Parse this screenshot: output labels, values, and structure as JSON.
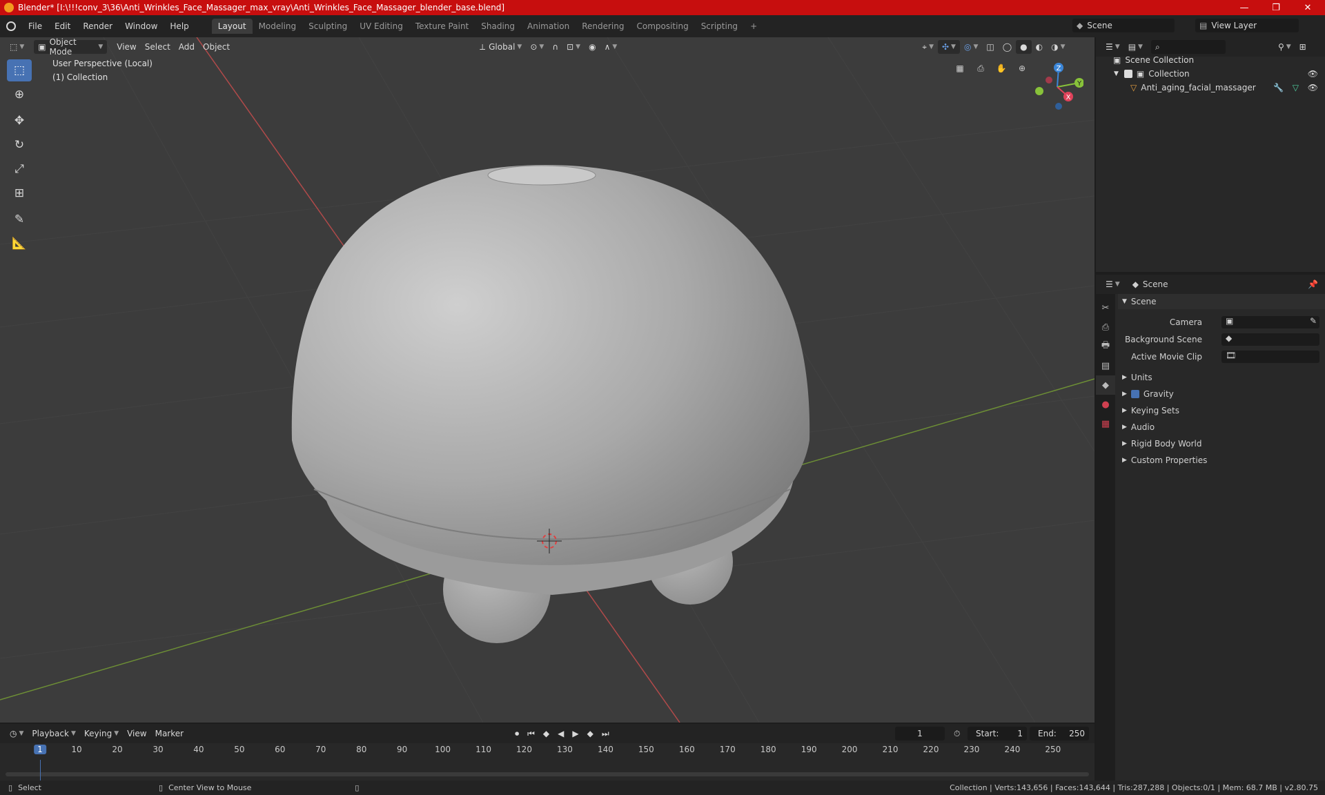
{
  "window": {
    "title": "Blender* [I:\\!!!conv_3\\36\\Anti_Wrinkles_Face_Massager_max_vray\\Anti_Wrinkles_Face_Massager_blender_base.blend]",
    "minimize": "—",
    "maximize": "❐",
    "close": "✕"
  },
  "menu": {
    "items": [
      "File",
      "Edit",
      "Render",
      "Window",
      "Help"
    ],
    "workspaces": [
      "Layout",
      "Modeling",
      "Sculpting",
      "UV Editing",
      "Texture Paint",
      "Shading",
      "Animation",
      "Rendering",
      "Compositing",
      "Scripting"
    ],
    "add_workspace": "+",
    "scene": "Scene",
    "view_layer": "View Layer"
  },
  "viewport_header": {
    "mode": "Object Mode",
    "menus": [
      "View",
      "Select",
      "Add",
      "Object"
    ],
    "orientation": "Global"
  },
  "viewport": {
    "overlay_line1": "User Perspective (Local)",
    "overlay_line2": "(1) Collection",
    "gizmo": {
      "x": "X",
      "y": "Y",
      "z": "Z"
    }
  },
  "outliner": {
    "search_placeholder": "",
    "rows": {
      "scene_collection": "Scene Collection",
      "collection": "Collection",
      "object": "Anti_aging_facial_massager"
    }
  },
  "properties": {
    "breadcrumb": "Scene",
    "panel_title": "Scene",
    "camera_label": "Camera",
    "background_scene_label": "Background Scene",
    "active_movie_clip_label": "Active Movie Clip",
    "subpanels": {
      "units": "Units",
      "gravity": "Gravity",
      "keying_sets": "Keying Sets",
      "audio": "Audio",
      "rigid_body_world": "Rigid Body World",
      "custom_properties": "Custom Properties"
    }
  },
  "timeline": {
    "menus": [
      "Playback",
      "Keying",
      "View",
      "Marker"
    ],
    "current_frame": "1",
    "start_label": "Start:",
    "start_value": "1",
    "end_label": "End:",
    "end_value": "250",
    "frame_labels": [
      "1",
      "10",
      "20",
      "30",
      "40",
      "50",
      "60",
      "70",
      "80",
      "90",
      "100",
      "110",
      "120",
      "130",
      "140",
      "150",
      "160",
      "170",
      "180",
      "190",
      "200",
      "210",
      "220",
      "230",
      "240",
      "250"
    ]
  },
  "statusbar": {
    "select": "Select",
    "center_view": "Center View to Mouse",
    "stats": "Collection | Verts:143,656 | Faces:143,644 | Tris:287,288 | Objects:0/1 | Mem: 68.7 MB | v2.80.75"
  },
  "colors": {
    "title_bar": "#c70e0e",
    "accent": "#4772b3",
    "axis_x": "#e0425a",
    "axis_y": "#88c23a",
    "axis_z": "#3b86d8"
  }
}
